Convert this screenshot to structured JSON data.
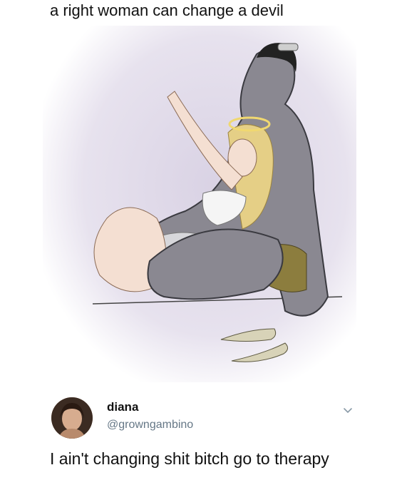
{
  "caption": "a right woman can change a devil",
  "tweet": {
    "author_name": "diana",
    "author_handle": "@growngambino",
    "text": "I ain't changing shit bitch go to therapy"
  },
  "icons": {
    "avatar": "profile-photo",
    "menu": "chevron-down-icon"
  },
  "colors": {
    "handle": "#657786",
    "backdrop": "#cfc6dc",
    "devil_skin": "#8a8891"
  }
}
